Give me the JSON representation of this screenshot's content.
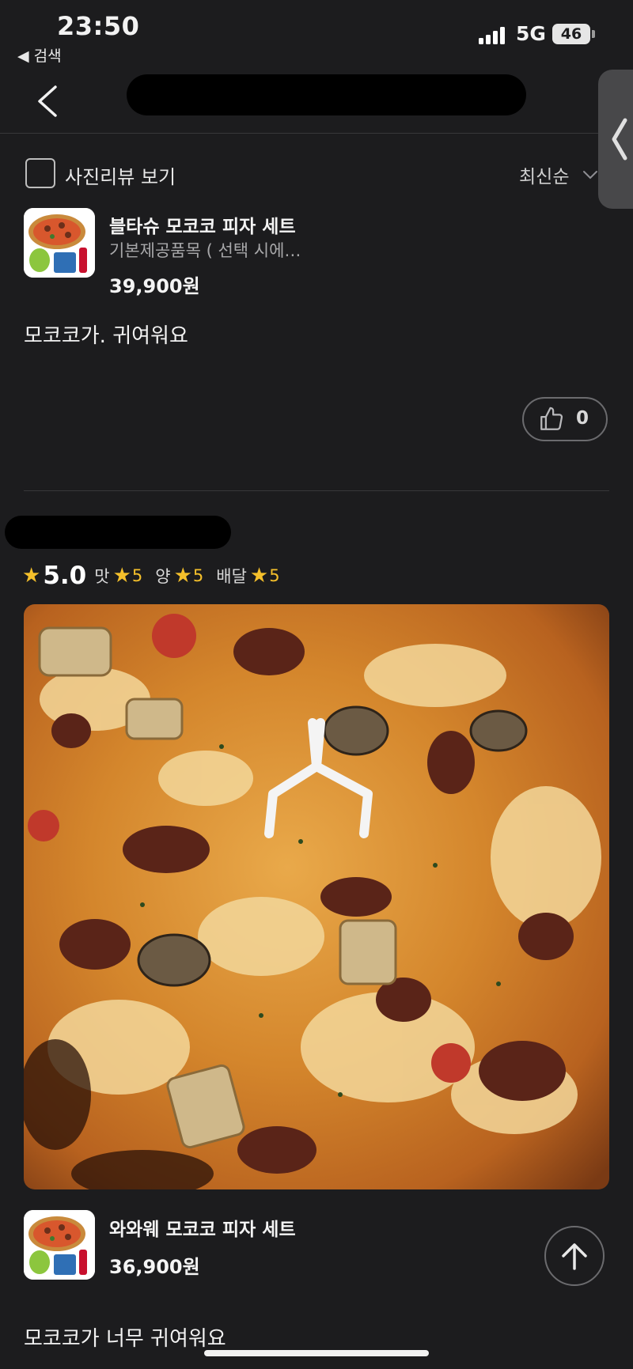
{
  "status_bar": {
    "time": "23:50",
    "back_label": "◀ 검색",
    "network": "5G",
    "battery": "46"
  },
  "filter": {
    "photo_review_label": "사진리뷰 보기",
    "sort_label": "최신순"
  },
  "reviews": [
    {
      "product": {
        "name": "블타슈 모코코 피자 세트",
        "option": "기본제공품목 ( 선택 시에…",
        "price": "39,900원"
      },
      "text": "모코코가. 귀여워요",
      "likes": "0"
    },
    {
      "rating": {
        "overall": "5.0",
        "taste_label": "맛",
        "taste": "5",
        "amount_label": "양",
        "amount": "5",
        "delivery_label": "배달",
        "delivery": "5"
      },
      "product": {
        "name": "와와웨 모코코 피자 세트",
        "price": "36,900원"
      },
      "text": "모코코가 너무 귀여워요"
    }
  ],
  "colors": {
    "background": "#1c1c1e",
    "star": "#f5c02b",
    "divider": "#38383a"
  }
}
